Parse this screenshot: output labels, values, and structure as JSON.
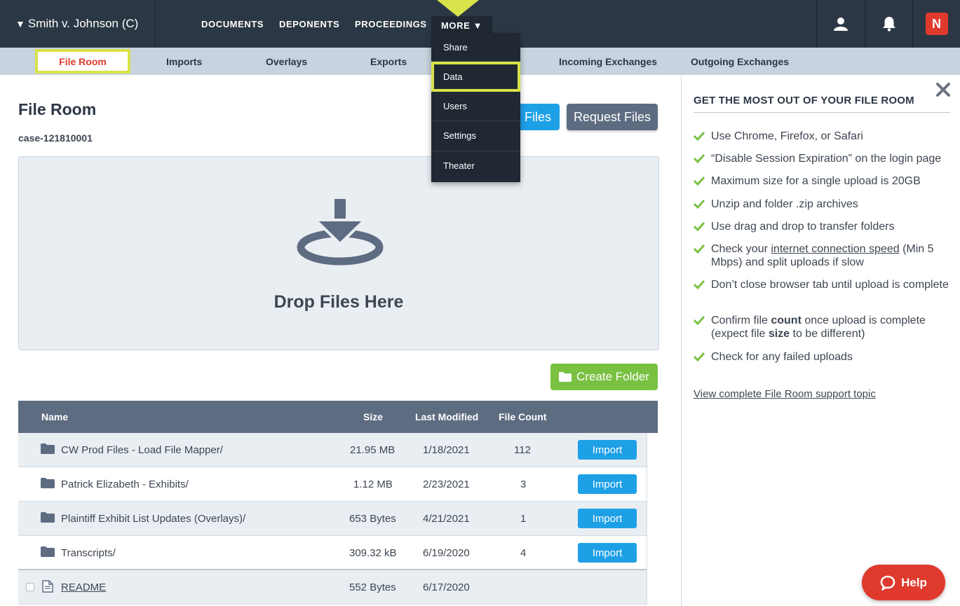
{
  "topbar": {
    "case_name": "Smith v. Johnson (C)",
    "case_caret": "▼",
    "nav": [
      "DOCUMENTS",
      "DEPONENTS",
      "PROCEEDINGS"
    ],
    "more_label": "MORE",
    "more_caret": "▼",
    "logo_letter": "N"
  },
  "subnav": {
    "active": "File Room",
    "items": [
      "Imports",
      "Overlays",
      "Exports",
      "Incoming Exchanges",
      "Outgoing Exchanges"
    ]
  },
  "more_menu": {
    "items": [
      "Share",
      "Data",
      "Users",
      "Settings",
      "Theater"
    ],
    "highlighted": "Data"
  },
  "main": {
    "title": "File Room",
    "case_id": "case-121810001",
    "upload_partial_label": "l Files",
    "request_label": "Request Files",
    "drop_text": "Drop Files Here",
    "create_folder_label": "Create Folder"
  },
  "table": {
    "headers": [
      "Name",
      "Size",
      "Last Modified",
      "File Count"
    ],
    "rows": [
      {
        "name": "CW Prod Files - Load File Mapper/",
        "size": "21.95 MB",
        "modified": "1/18/2021",
        "count": "112",
        "action": "Import"
      },
      {
        "name": "Patrick Elizabeth - Exhibits/",
        "size": "1.12 MB",
        "modified": "2/23/2021",
        "count": "3",
        "action": "Import"
      },
      {
        "name": "Plaintiff Exhibit List Updates (Overlays)/",
        "size": "653 Bytes",
        "modified": "4/21/2021",
        "count": "1",
        "action": "Import"
      },
      {
        "name": "Transcripts/",
        "size": "309.32 kB",
        "modified": "6/19/2020",
        "count": "4",
        "action": "Import"
      },
      {
        "name": "README",
        "size": "552 Bytes",
        "modified": "6/17/2020",
        "count": "",
        "action": ""
      }
    ]
  },
  "panel": {
    "title": "GET THE MOST OUT OF YOUR FILE ROOM",
    "tips": {
      "t1": "Use Chrome, Firefox, or Safari",
      "t2": "“Disable Session Expiration” on the login page",
      "t3": "Maximum size for a single upload is 20GB",
      "t4": "Unzip and folder .zip archives",
      "t5": "Use drag and drop to transfer folders",
      "t6_pre": "Check your ",
      "t6_link": "internet connection speed",
      "t6_post": " (Min 5 Mbps) and split uploads if slow",
      "t7": "Don’t close browser tab until upload is complete",
      "t8_pre": "Confirm file ",
      "t8_b1": "count",
      "t8_mid": " once upload is complete (expect file ",
      "t8_b2": "size",
      "t8_post": " to be different)",
      "t9": "Check for any failed uploads"
    },
    "link": "View complete File Room support topic"
  },
  "help_label": "Help",
  "colors": {
    "nav_bg": "#2c3745",
    "highlight": "#d8e24a",
    "accent_red": "#e03a2e",
    "import_blue": "#1ea0e6",
    "folder_green": "#7ac142"
  }
}
